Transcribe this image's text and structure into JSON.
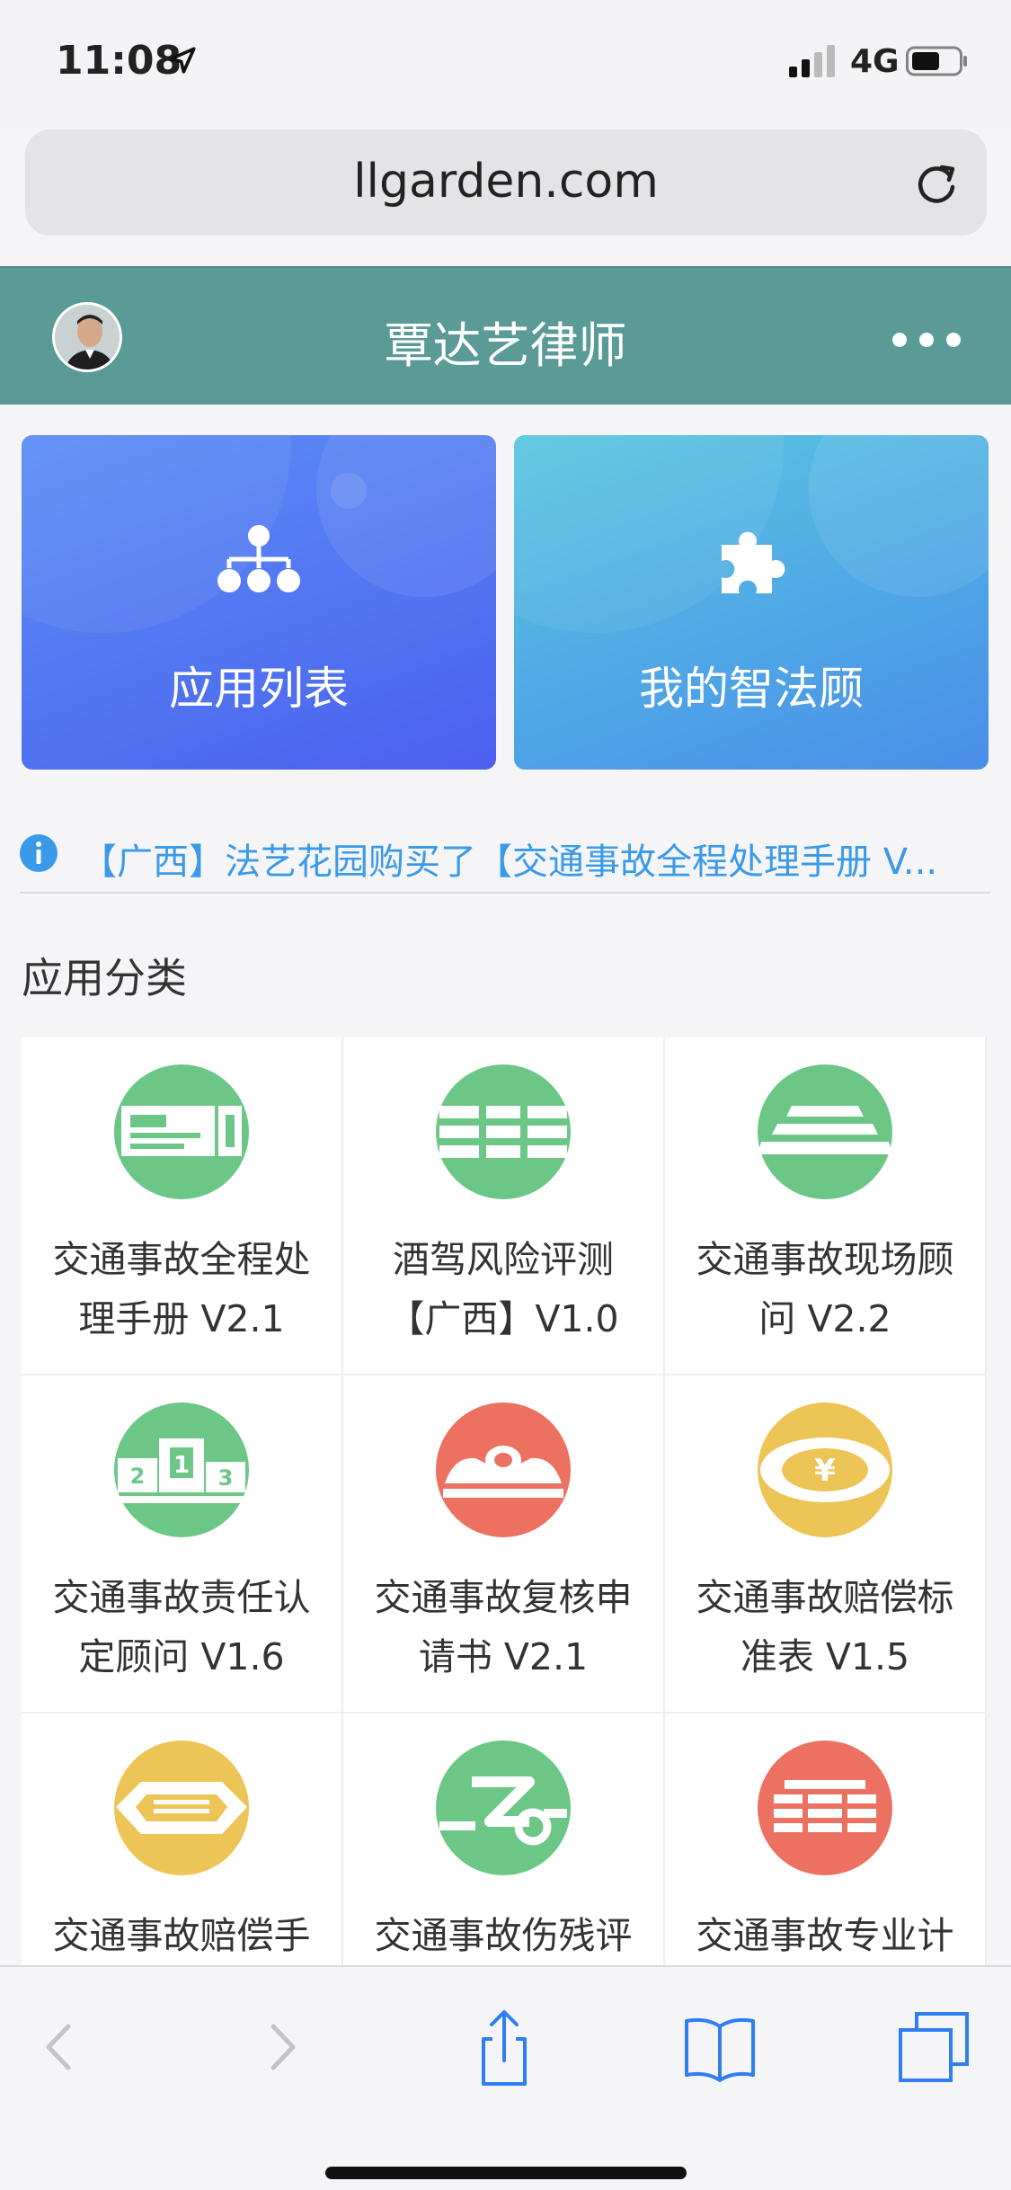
{
  "status_bar": {
    "time": "11:08",
    "network": "4G"
  },
  "browser": {
    "url": "llgarden.com"
  },
  "header": {
    "title": "覃达艺律师"
  },
  "cards": [
    {
      "label": "应用列表",
      "icon": "sitemap-icon"
    },
    {
      "label": "我的智法顾",
      "icon": "puzzle-icon"
    }
  ],
  "notice": {
    "text": "【广西】法艺花园购买了【交通事故全程处理手册 V..."
  },
  "section": {
    "title": "应用分类"
  },
  "apps": [
    {
      "line1": "交通事故全程处",
      "line2": "理手册 V2.1",
      "icon": "handbook-icon",
      "color": "#6cc787"
    },
    {
      "line1": "酒驾风险评测",
      "line2": "【广西】V1.0",
      "icon": "table-icon",
      "color": "#6cc787"
    },
    {
      "line1": "交通事故现场顾",
      "line2": "问 V2.2",
      "icon": "scene-icon",
      "color": "#6cc787"
    },
    {
      "line1": "交通事故责任认",
      "line2": "定顾问 V1.6",
      "icon": "podium-icon",
      "color": "#6cc787"
    },
    {
      "line1": "交通事故复核申",
      "line2": "请书 V2.1",
      "icon": "review-icon",
      "color": "#ec7161"
    },
    {
      "line1": "交通事故赔偿标",
      "line2": "准表 V1.5",
      "icon": "yen-icon",
      "color": "#edc456"
    },
    {
      "line1": "交通事故赔偿手",
      "line2": "",
      "icon": "tray-icon",
      "color": "#edc456"
    },
    {
      "line1": "交通事故伤残评",
      "line2": "",
      "icon": "disability-icon",
      "color": "#6cc787"
    },
    {
      "line1": "交通事故专业计",
      "line2": "",
      "icon": "calculator-icon",
      "color": "#ec7161"
    }
  ],
  "toolbar": {
    "back": "back-icon",
    "forward": "forward-icon",
    "share": "share-icon",
    "bookmarks": "bookmarks-icon",
    "tabs": "tabs-icon"
  }
}
